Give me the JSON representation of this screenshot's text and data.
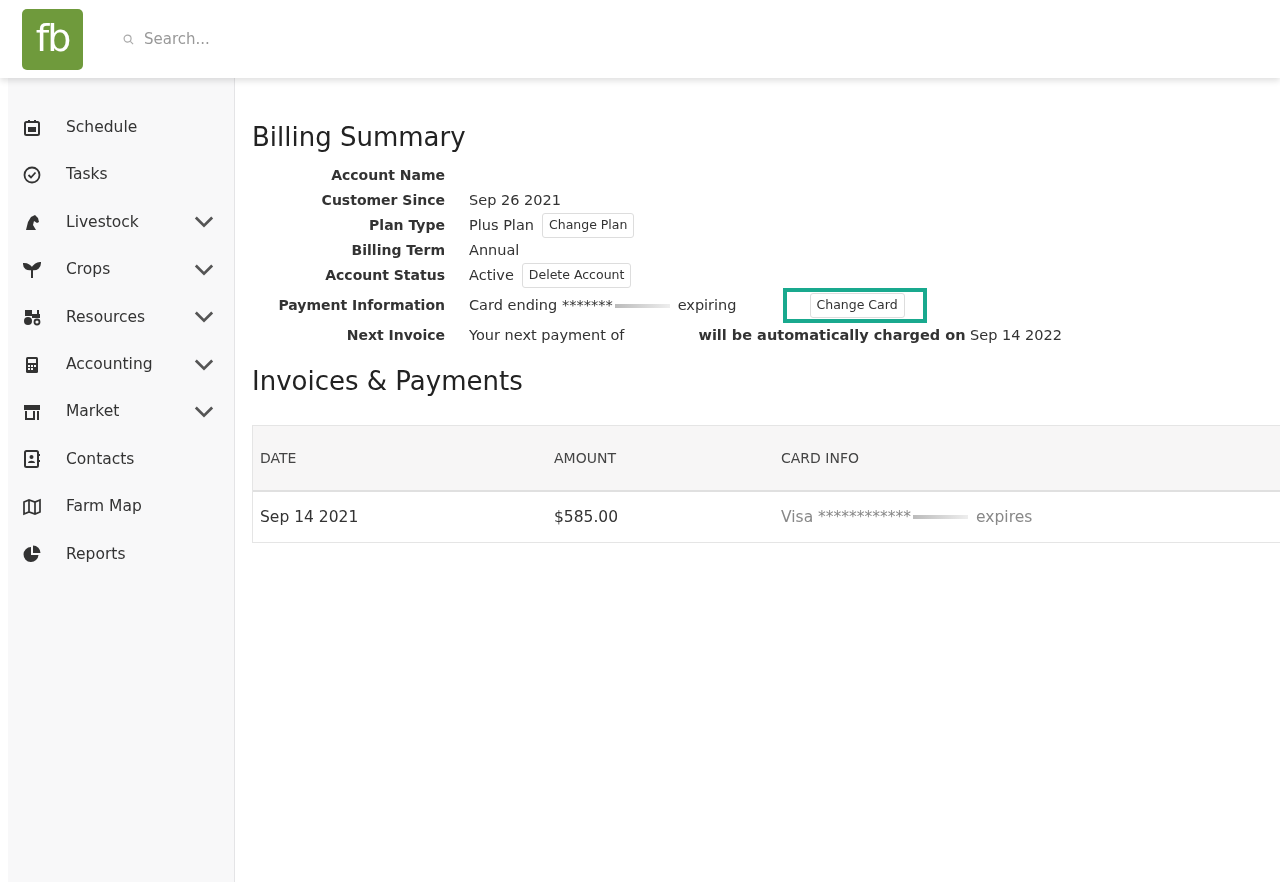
{
  "header": {
    "logo": "fb",
    "search": {
      "placeholder": "Search..."
    }
  },
  "sidebar": {
    "items": [
      {
        "label": "Schedule",
        "expandable": false
      },
      {
        "label": "Tasks",
        "expandable": false
      },
      {
        "label": "Livestock",
        "expandable": true
      },
      {
        "label": "Crops",
        "expandable": true
      },
      {
        "label": "Resources",
        "expandable": true
      },
      {
        "label": "Accounting",
        "expandable": true
      },
      {
        "label": "Market",
        "expandable": true
      },
      {
        "label": "Contacts",
        "expandable": false
      },
      {
        "label": "Farm Map",
        "expandable": false
      },
      {
        "label": "Reports",
        "expandable": false
      }
    ]
  },
  "billing_summary": {
    "title": "Billing Summary",
    "rows": [
      {
        "kind": "plain",
        "label": "Account Name"
      },
      {
        "kind": "plain",
        "label": "Customer Since",
        "value": "Sep 26 2021"
      },
      {
        "kind": "plain",
        "label": "Plan Type",
        "value": "Plus Plan",
        "button": {
          "label": "Change Plan",
          "highlighted": false
        }
      },
      {
        "kind": "plain",
        "label": "Billing Term",
        "value": "Annual"
      },
      {
        "kind": "plain",
        "label": "Account Status",
        "value": "Active",
        "button": {
          "label": "Delete Account",
          "highlighted": false
        }
      },
      {
        "kind": "redacted",
        "label": "Payment Information",
        "value": "Card ending *******",
        "value_2": "expiring",
        "button": {
          "label": "Change Card",
          "highlighted": true
        }
      },
      {
        "kind": "gap",
        "label": "Next Invoice",
        "value": "Your next payment of",
        "value_2": "**will be automatically charged on** Sep 14 2022"
      }
    ]
  },
  "invoices": {
    "title": "Invoices & Payments",
    "table": {
      "columns": [
        "DATE",
        "AMOUNT",
        "CARD INFO"
      ],
      "rows": [
        {
          "date": "Sep 14 2021",
          "amount": "$585.00",
          "card": "Visa ************",
          "card_2": "expires"
        }
      ]
    }
  }
}
